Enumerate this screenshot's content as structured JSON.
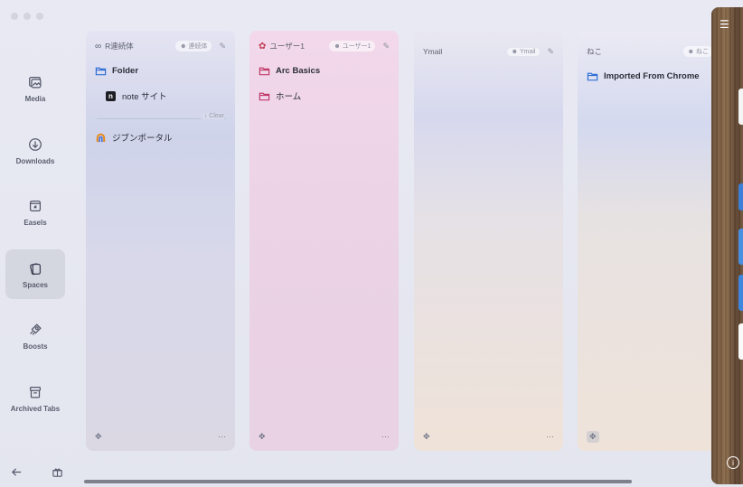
{
  "sidebar": {
    "items": [
      {
        "label": "Media",
        "icon": "media-icon"
      },
      {
        "label": "Downloads",
        "icon": "download-icon"
      },
      {
        "label": "Easels",
        "icon": "easel-icon"
      },
      {
        "label": "Spaces",
        "icon": "spaces-icon",
        "active": true
      },
      {
        "label": "Boosts",
        "icon": "boosts-icon"
      },
      {
        "label": "Archived Tabs",
        "icon": "archive-icon"
      }
    ]
  },
  "spaces": [
    {
      "title": "R連続体",
      "profile": "連続体",
      "items": [
        {
          "label": "Folder",
          "type": "folder"
        },
        {
          "label": "note サイト",
          "type": "tab"
        }
      ],
      "clear_label": "↓ Clear",
      "unpinned": [
        {
          "label": "ジブンポータル",
          "type": "tab"
        }
      ]
    },
    {
      "title": "ユーザー1",
      "profile": "ユーザー1",
      "items": [
        {
          "label": "Arc Basics",
          "type": "folder"
        },
        {
          "label": "ホーム",
          "type": "folder"
        }
      ]
    },
    {
      "title": "Ymail",
      "profile": "Ymail",
      "items": []
    },
    {
      "title": "ねこ",
      "profile": "ねこ",
      "items": [
        {
          "label": "Imported From Chrome",
          "type": "folder"
        }
      ]
    }
  ],
  "footer_more": "···",
  "colors": {
    "folder_blue": "#2f6fd6",
    "folder_pink": "#c03a6a",
    "sidebar_active": "#d4d6e0"
  }
}
